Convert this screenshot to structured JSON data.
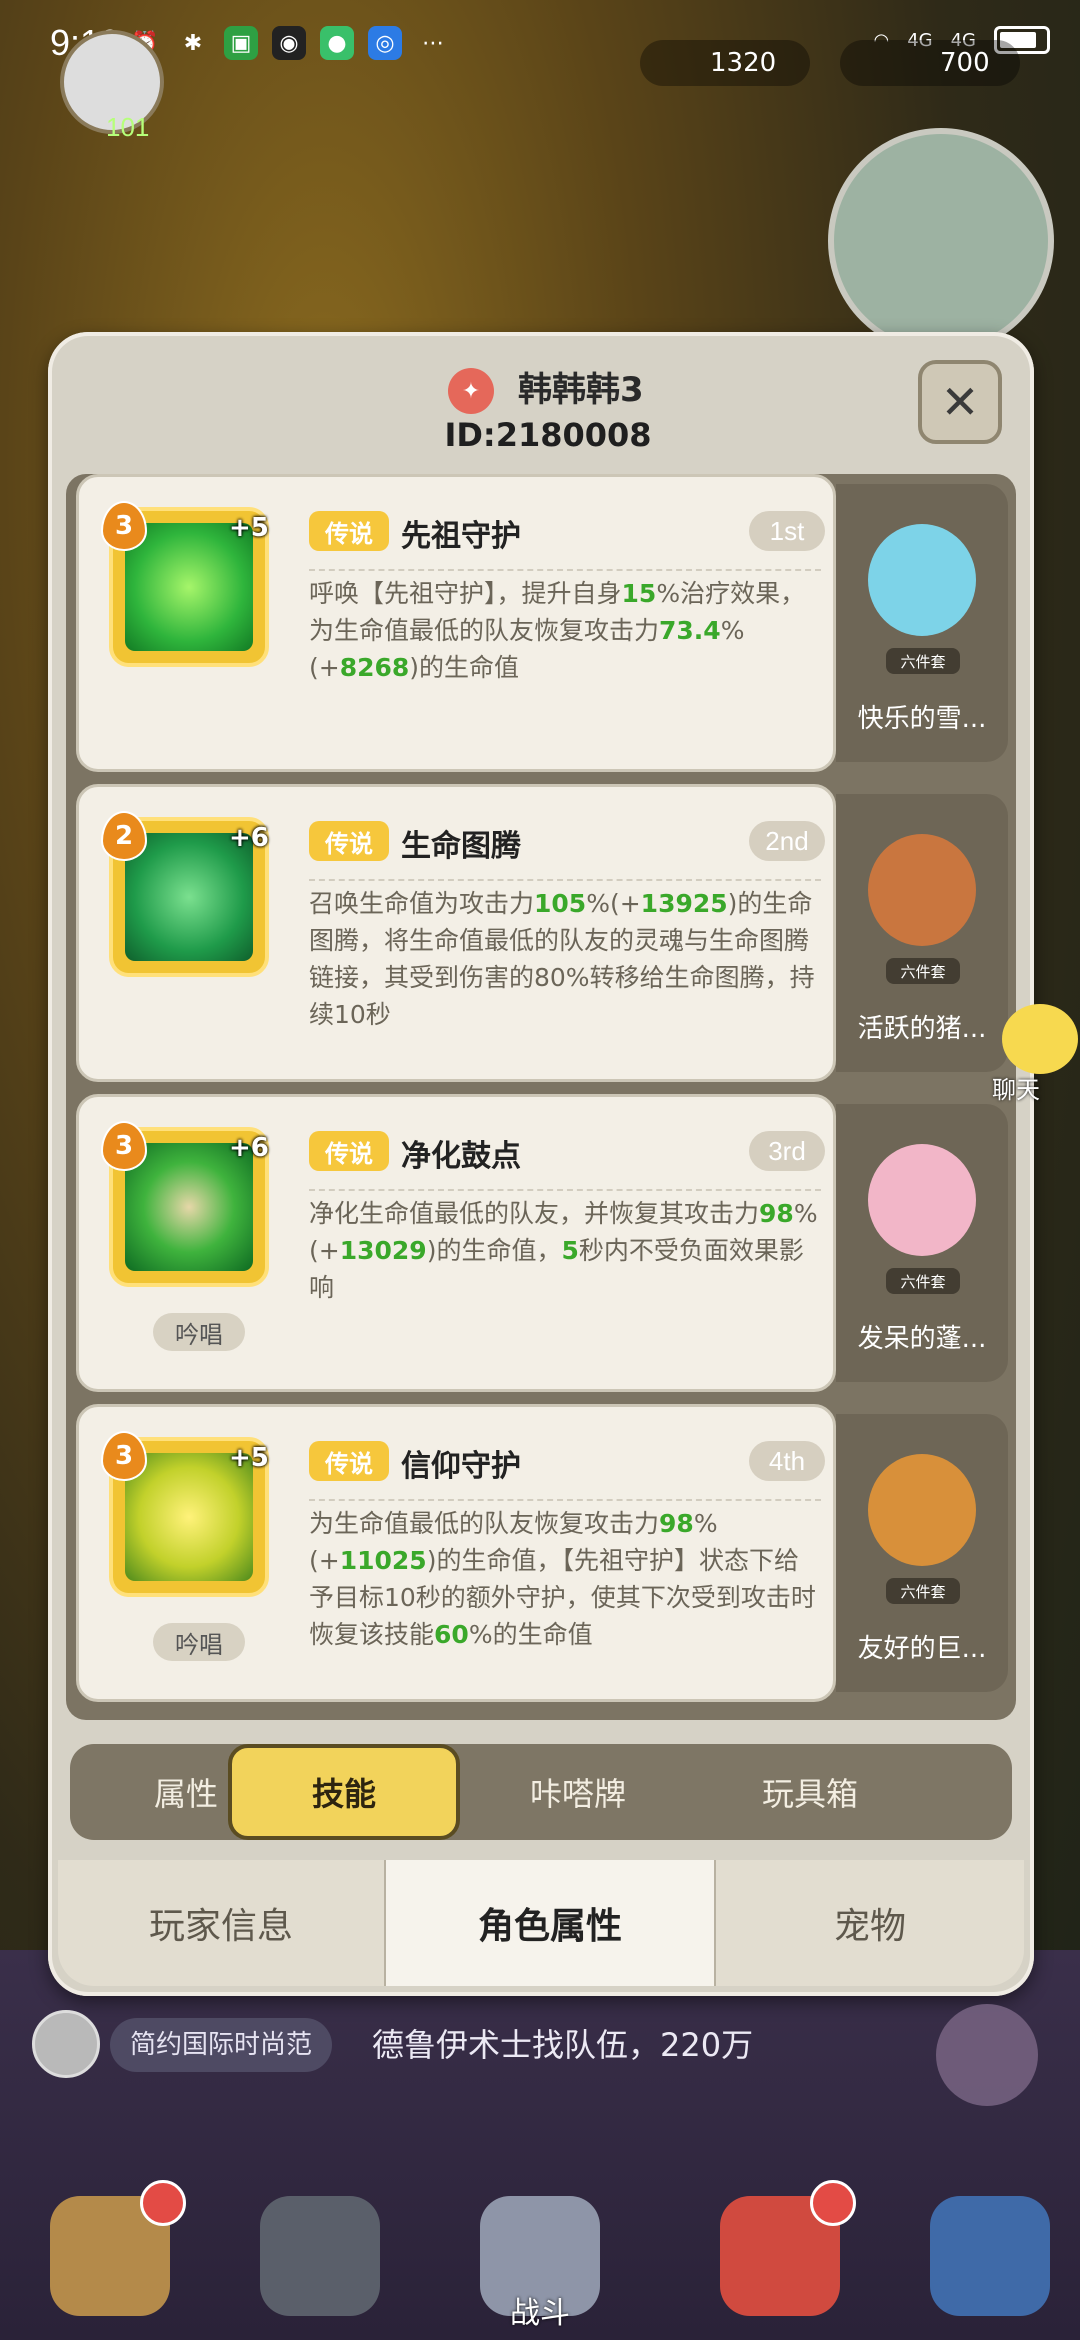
{
  "status_bar": {
    "time": "9:10",
    "signal_text_1": "4G",
    "signal_text_2": "4G"
  },
  "hud": {
    "level": "101",
    "coins": "1320",
    "gems": "700"
  },
  "panel": {
    "player_name": "韩韩韩3",
    "player_id": "ID:2180008"
  },
  "skills": [
    {
      "level": "3",
      "plus": "+5",
      "rarity": "传说",
      "name": "先祖守护",
      "rank": "1st",
      "chant": "",
      "desc": [
        "呼唤【先祖守护】，提升自身",
        "15",
        "%治疗效果，为生命值最低的队友恢复攻击力",
        "73.4",
        "%(+",
        "8268",
        ")的生命值"
      ],
      "pet_name": "快乐的雪...",
      "set": "六件套"
    },
    {
      "level": "2",
      "plus": "+6",
      "rarity": "传说",
      "name": "生命图腾",
      "rank": "2nd",
      "chant": "",
      "desc": [
        "召唤生命值为攻击力",
        "105",
        "%(+",
        "13925",
        ")的生命图腾，将生命值最低的队友的灵魂与生命图腾链接，其受到伤害的80%转移给生命图腾，持续10秒"
      ],
      "pet_name": "活跃的猪...",
      "set": "六件套"
    },
    {
      "level": "3",
      "plus": "+6",
      "rarity": "传说",
      "name": "净化鼓点",
      "rank": "3rd",
      "chant": "吟唱",
      "desc": [
        "净化生命值最低的队友，并恢复其攻击力",
        "98",
        "%(+",
        "13029",
        ")的生命值，",
        "5",
        "秒内不受负面效果影响"
      ],
      "pet_name": "发呆的蓬...",
      "set": "六件套"
    },
    {
      "level": "3",
      "plus": "+5",
      "rarity": "传说",
      "name": "信仰守护",
      "rank": "4th",
      "chant": "吟唱",
      "desc": [
        "为生命值最低的队友恢复攻击力",
        "98",
        "%(+",
        "11025",
        ")的生命值，【先祖守护】状态下给予目标10秒的额外守护，使其下次受到攻击时恢复该技能",
        "60",
        "%的生命值"
      ],
      "pet_name": "友好的巨...",
      "set": "六件套"
    }
  ],
  "sub_tabs": [
    {
      "label": "属性"
    },
    {
      "label": "技能"
    },
    {
      "label": "咔嗒牌"
    },
    {
      "label": "玩具箱"
    }
  ],
  "bottom_tabs": [
    {
      "label": "玩家信息"
    },
    {
      "label": "角色属性"
    },
    {
      "label": "宠物"
    }
  ],
  "chat": {
    "side_label": "聊天",
    "guild_tag": "简约国际时尚范",
    "message": "德鲁伊术士找队伍，220万"
  },
  "nav": {
    "battle_label": "战斗"
  },
  "colors": {
    "accent_gold": "#f2d35b",
    "legend_tag": "#f6c73c",
    "highlight_green": "#3aa82a"
  }
}
